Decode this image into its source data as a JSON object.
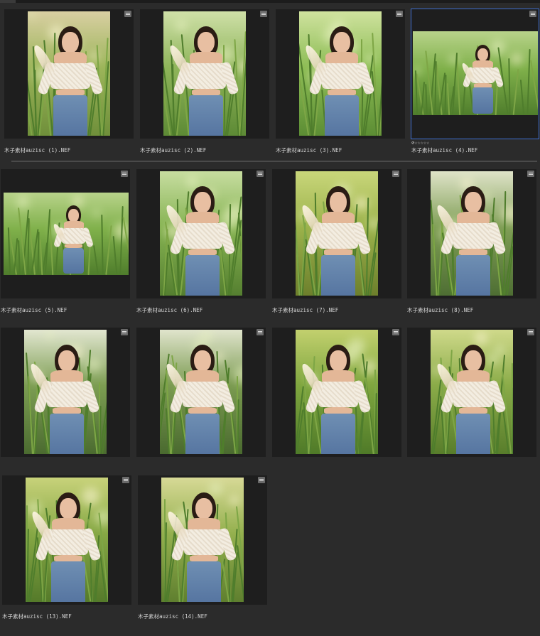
{
  "topbar": {
    "tab_label": ""
  },
  "photos": [
    {
      "filename": "木子素材auzisc (1).NEF",
      "orientation": "portrait",
      "selected": false,
      "rating": ""
    },
    {
      "filename": "木子素材auzisc (2).NEF",
      "orientation": "portrait",
      "selected": false,
      "rating": ""
    },
    {
      "filename": "木子素材auzisc (3).NEF",
      "orientation": "portrait",
      "selected": false,
      "rating": ""
    },
    {
      "filename": "木子素材auzisc (4).NEF",
      "orientation": "landscape",
      "selected": true,
      "rating": "⊘☆☆☆☆☆"
    },
    {
      "filename": "木子素材auzisc (5).NEF",
      "orientation": "landscape",
      "selected": false,
      "rating": ""
    },
    {
      "filename": "木子素材auzisc (6).NEF",
      "orientation": "portrait",
      "selected": false,
      "rating": ""
    },
    {
      "filename": "木子素材auzisc (7).NEF",
      "orientation": "portrait",
      "selected": false,
      "rating": ""
    },
    {
      "filename": "木子素材auzisc (8).NEF",
      "orientation": "portrait",
      "selected": false,
      "rating": ""
    },
    {
      "filename": "",
      "orientation": "portrait",
      "selected": false,
      "rating": ""
    },
    {
      "filename": "",
      "orientation": "portrait",
      "selected": false,
      "rating": ""
    },
    {
      "filename": "",
      "orientation": "portrait",
      "selected": false,
      "rating": ""
    },
    {
      "filename": "",
      "orientation": "portrait",
      "selected": false,
      "rating": ""
    },
    {
      "filename": "木子素材auzisc (13).NEF",
      "orientation": "portrait",
      "selected": false,
      "rating": ""
    },
    {
      "filename": "木子素材auzisc (14).NEF",
      "orientation": "portrait",
      "selected": false,
      "rating": ""
    }
  ],
  "colors": {
    "background": "#2b2b2b",
    "thumbnail_bg": "#1e1e1e",
    "selection": "#3f6fd0",
    "caption_text": "#d6d6d6"
  },
  "icons": {
    "badge": "edit-settings-icon",
    "rating_reject": "reject-icon",
    "rating_star": "star-outline-icon"
  }
}
